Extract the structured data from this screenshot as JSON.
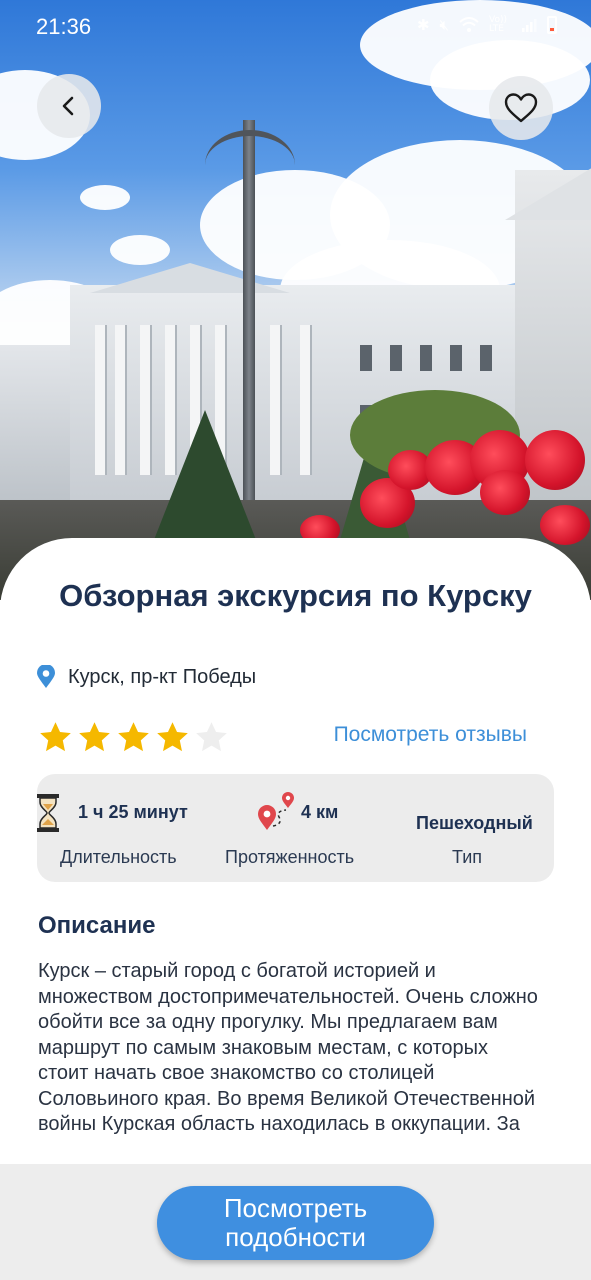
{
  "status_bar": {
    "time": "21:36",
    "icons": [
      "bluetooth-icon",
      "mute-icon",
      "wifi-icon",
      "volte-icon",
      "signal-icon",
      "battery-icon"
    ],
    "volte_label": "Vo)) LTE"
  },
  "hero": {
    "back_icon": "chevron-left-icon",
    "favorite_icon": "heart-outline-icon"
  },
  "tour": {
    "title": "Обзорная экскурсия по Курску",
    "location": "Курск, пр-кт Победы",
    "rating": 4,
    "rating_max": 5,
    "reviews_link": "Посмотреть отзывы"
  },
  "info": {
    "duration": {
      "value": "1 ч 25 минут",
      "label": "Длительность",
      "icon": "hourglass-icon"
    },
    "distance": {
      "value": "4 км",
      "label": "Протяженность",
      "icon": "route-pins-icon"
    },
    "type": {
      "value": "Пешеходный",
      "label": "Тип"
    }
  },
  "description": {
    "title": "Описание",
    "text": "Курск – старый город с богатой историей и множеством достопримечательностей. Очень сложно обойти все за одну прогулку. Мы предлагаем вам маршрут по самым знаковым местам, с которых стоит начать свое знакомство со столицей Соловьиного края. Во время Великой Отечественной войны Курская область находилась в оккупации. За"
  },
  "cta": {
    "label": "Посмотреть подобности"
  },
  "colors": {
    "accent": "#3f8fe0",
    "link": "#3d8fd8",
    "star": "#f5b800",
    "title": "#1e3152"
  }
}
